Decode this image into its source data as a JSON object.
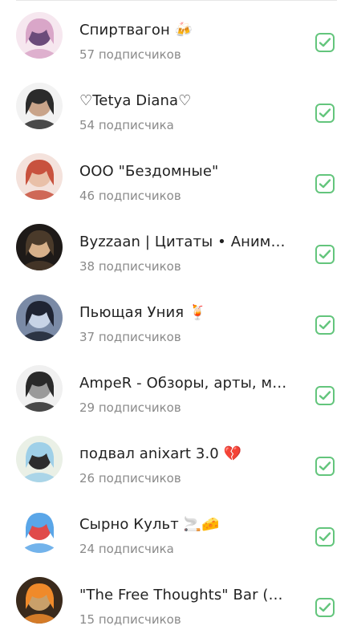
{
  "channels": [
    {
      "title": "Спиртвагон 🍻",
      "subscribers": "57 подписчиков",
      "subscribed": true,
      "avatar_icon": "anime-girl-pink-hair-avatar",
      "colors": [
        "#f6e7ef",
        "#d9a6c8",
        "#6b4b7a"
      ]
    },
    {
      "title": "♡Tetya Diana♡",
      "subscribers": "54 подписчика",
      "subscribed": true,
      "avatar_icon": "man-in-suit-avatar",
      "colors": [
        "#f2f2f2",
        "#2b2b2b",
        "#c9a48a"
      ]
    },
    {
      "title": "ООО \"Бездомные\"",
      "subscribers": "46 подписчиков",
      "subscribed": true,
      "avatar_icon": "anime-girl-red-hair-avatar",
      "colors": [
        "#f4e2dc",
        "#c8523e",
        "#e9c0a8"
      ]
    },
    {
      "title": "Byzzaan | Цитаты • Аниме...",
      "subscribers": "38 подписчиков",
      "subscribed": true,
      "avatar_icon": "dark-anime-figure-avatar",
      "colors": [
        "#1e1a18",
        "#4a3a2a",
        "#d7b08a"
      ]
    },
    {
      "title": "Пьющая Уния 🍹",
      "subscribers": "37 подписчиков",
      "subscribed": true,
      "avatar_icon": "anime-dark-hair-avatar",
      "colors": [
        "#7a8aa6",
        "#1f2433",
        "#c7d3e6"
      ]
    },
    {
      "title": "AmpeR - Обзоры, арты, му...",
      "subscribers": "29 подписчиков",
      "subscribed": true,
      "avatar_icon": "manga-sketch-avatar",
      "colors": [
        "#f0f0f0",
        "#2a2a2a",
        "#9a9a9a"
      ]
    },
    {
      "title": "подвал anixart 3.0 💔",
      "subscribers": "26 подписчиков",
      "subscribed": true,
      "avatar_icon": "anime-light-blue-hair-avatar",
      "colors": [
        "#eaf0e6",
        "#9fd0e8",
        "#2d2d2d"
      ]
    },
    {
      "title": "Сырно Культ 🚬🧀",
      "subscribers": "24 подписчика",
      "subscribed": true,
      "avatar_icon": "cirno-blue-hair-avatar",
      "colors": [
        "#ffffff",
        "#5aa6e8",
        "#e04a4a"
      ]
    },
    {
      "title": "\"The Free Thoughts\" Bar (б...",
      "subscribers": "15 подписчиков",
      "subscribed": true,
      "avatar_icon": "cocktail-bar-avatar",
      "colors": [
        "#3a2a1c",
        "#f08a2a",
        "#c9a06a"
      ]
    }
  ],
  "accent_color": "#63c57c"
}
